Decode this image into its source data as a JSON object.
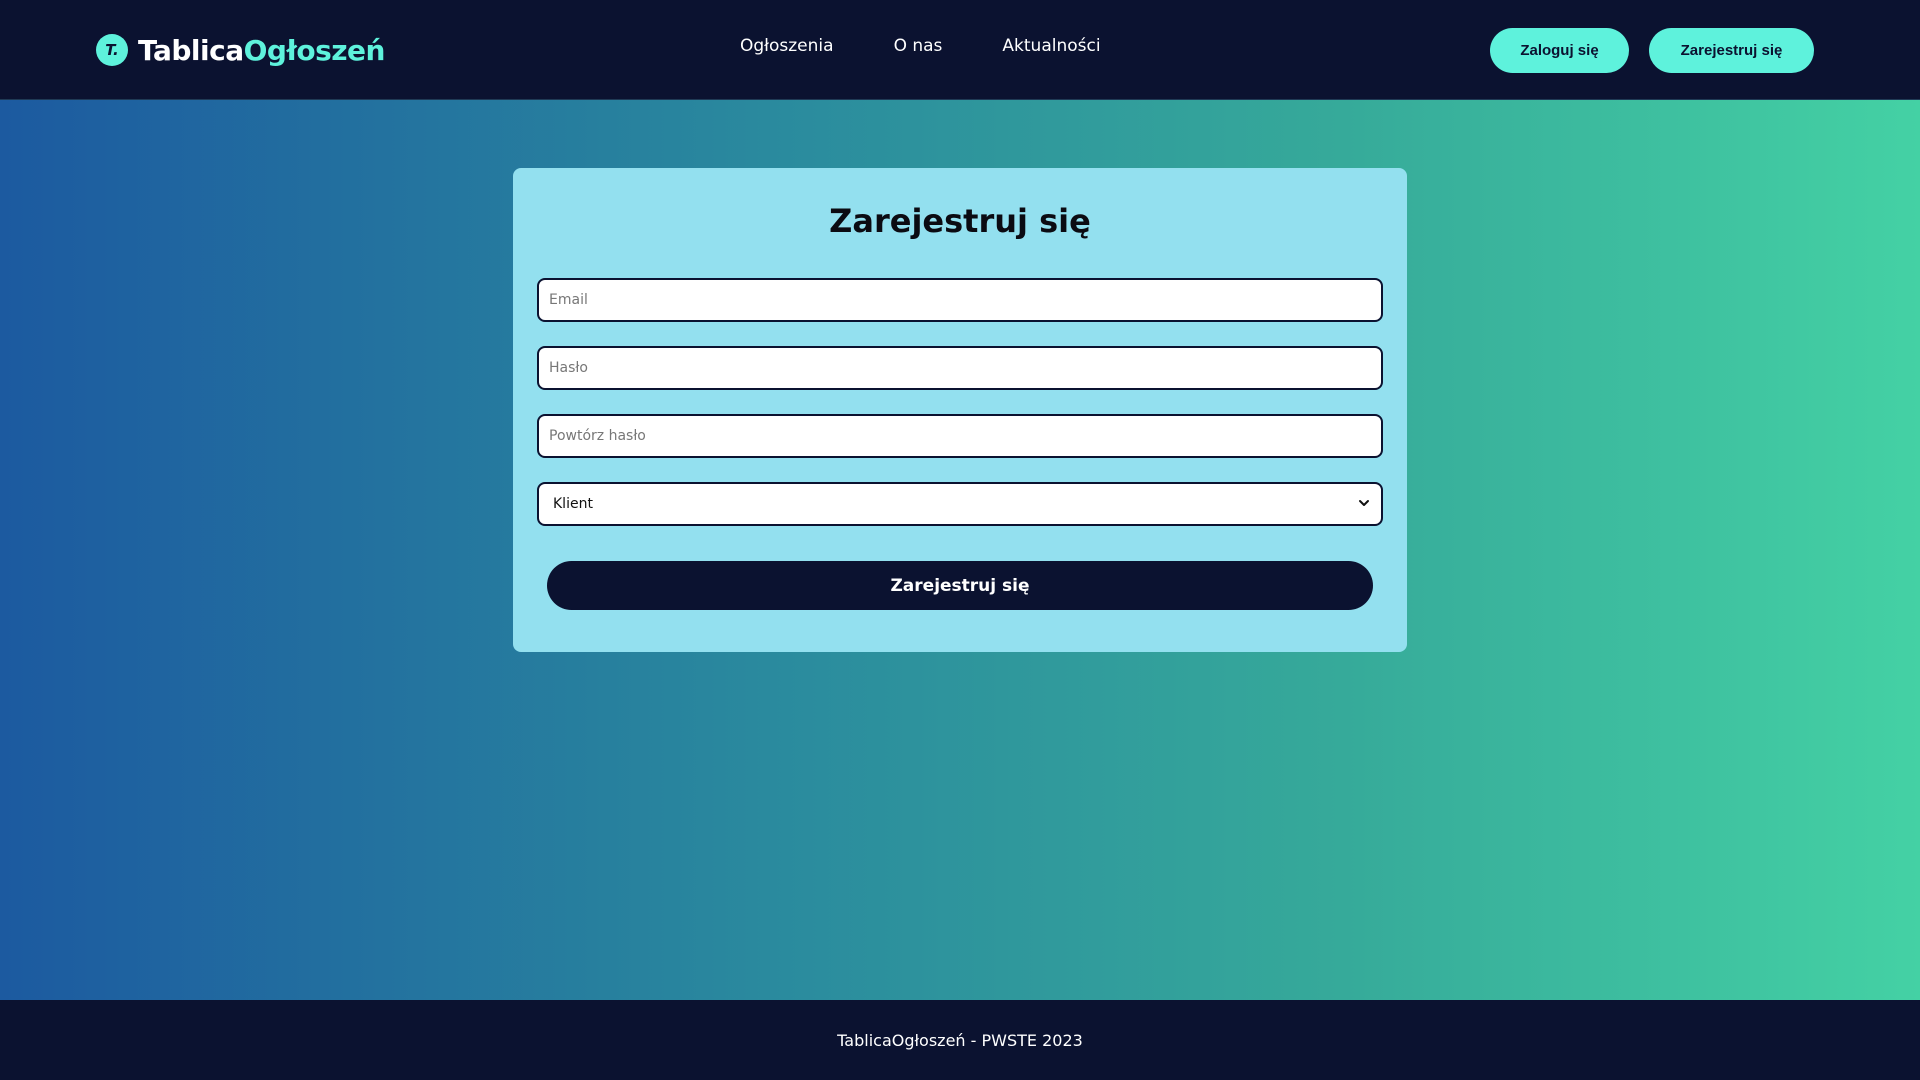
{
  "header": {
    "logo_badge": "T.",
    "logo_main": "Tablica",
    "logo_accent": "Ogłoszeń",
    "nav": [
      {
        "label": "Ogłoszenia"
      },
      {
        "label": "O nas"
      },
      {
        "label": "Aktualności"
      }
    ],
    "login_button": "Zaloguj się",
    "register_button": "Zarejestruj się"
  },
  "form": {
    "title": "Zarejestruj się",
    "email_placeholder": "Email",
    "password_placeholder": "Hasło",
    "repeat_password_placeholder": "Powtórz hasło",
    "account_type_selected": "Klient",
    "submit_label": "Zarejestruj się"
  },
  "footer": {
    "text": "TablicaOgłoszeń - PWSTE 2023"
  },
  "colors": {
    "nav_bg": "#0b1230",
    "accent": "#5ef2dc",
    "card_bg": "#93e0ef",
    "gradient_start": "#1c5aa0",
    "gradient_end": "#44d1a4"
  }
}
